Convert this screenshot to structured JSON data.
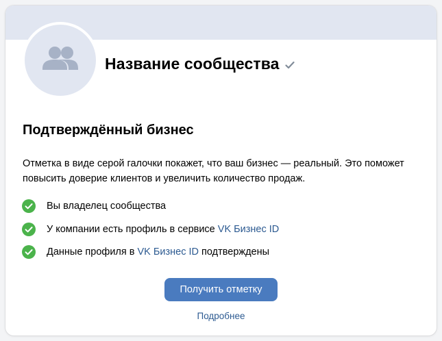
{
  "community": {
    "name": "Название сообщества",
    "verified_icon": "check-icon"
  },
  "avatar": {
    "icon": "users-icon"
  },
  "section": {
    "title": "Подтверждённый бизнес",
    "description": "Отметка в виде серой галочки покажет, что ваш бизнес — реальный. Это поможет повысить доверие клиентов и увеличить количество продаж."
  },
  "checklist": [
    {
      "icon": "check-circle-icon",
      "text_before": "Вы владелец сообщества",
      "link": "",
      "text_after": ""
    },
    {
      "icon": "check-circle-icon",
      "text_before": "У компании есть профиль в сервисе ",
      "link": "VK Бизнес ID",
      "text_after": ""
    },
    {
      "icon": "check-circle-icon",
      "text_before": "Данные профиля в ",
      "link": "VK Бизнес ID",
      "text_after": " подтверждены"
    }
  ],
  "actions": {
    "primary_label": "Получить отметку",
    "more_label": "Подробнее"
  },
  "colors": {
    "accent": "#4a7bbf",
    "link": "#2c5a91",
    "success": "#4bb34b",
    "cover": "#e1e6f1",
    "verified_gray": "#818c99"
  }
}
